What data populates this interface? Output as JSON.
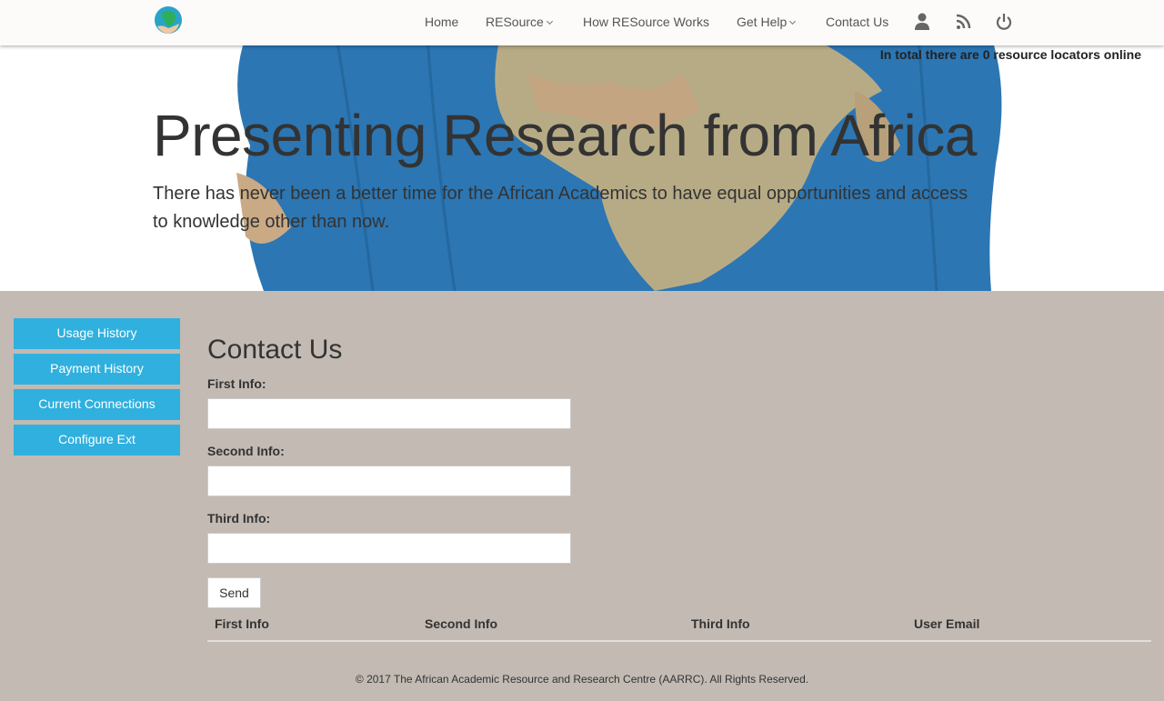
{
  "navbar": {
    "logo_alt": "AARRC globe logo",
    "links": [
      {
        "label": "Home",
        "has_dropdown": false
      },
      {
        "label": "RESource",
        "has_dropdown": true
      },
      {
        "label": "How RESource Works",
        "has_dropdown": false
      },
      {
        "label": "Get Help",
        "has_dropdown": true
      },
      {
        "label": "Contact Us",
        "has_dropdown": false
      }
    ],
    "icons": [
      "user-icon",
      "rss-icon",
      "power-icon"
    ]
  },
  "hero": {
    "online_status": "In total there are 0 resource locators online",
    "title": "Presenting Research from Africa",
    "subtitle": "There has never been a better time for the African Academics to have equal opportunities and access to knowledge other than now."
  },
  "sidebar": {
    "items": [
      {
        "label": "Usage History"
      },
      {
        "label": "Payment History"
      },
      {
        "label": "Current Connections"
      },
      {
        "label": "Configure Ext"
      }
    ]
  },
  "contact_form": {
    "title": "Contact Us",
    "fields": [
      {
        "label": "First Info:",
        "value": "",
        "placeholder": ""
      },
      {
        "label": "Second Info:",
        "value": "",
        "placeholder": ""
      },
      {
        "label": "Third Info:",
        "value": "",
        "placeholder": ""
      }
    ],
    "send_label": "Send"
  },
  "table": {
    "columns": [
      "First Info",
      "Second Info",
      "Third Info",
      "User Email"
    ],
    "rows": []
  },
  "footer": {
    "text": "© 2017 The African Academic Resource and Research Centre (AARRC). All Rights Reserved."
  },
  "colors": {
    "accent": "#30b0de",
    "page_background": "#c2bab3",
    "navbar_background": "#fcfbfa"
  }
}
